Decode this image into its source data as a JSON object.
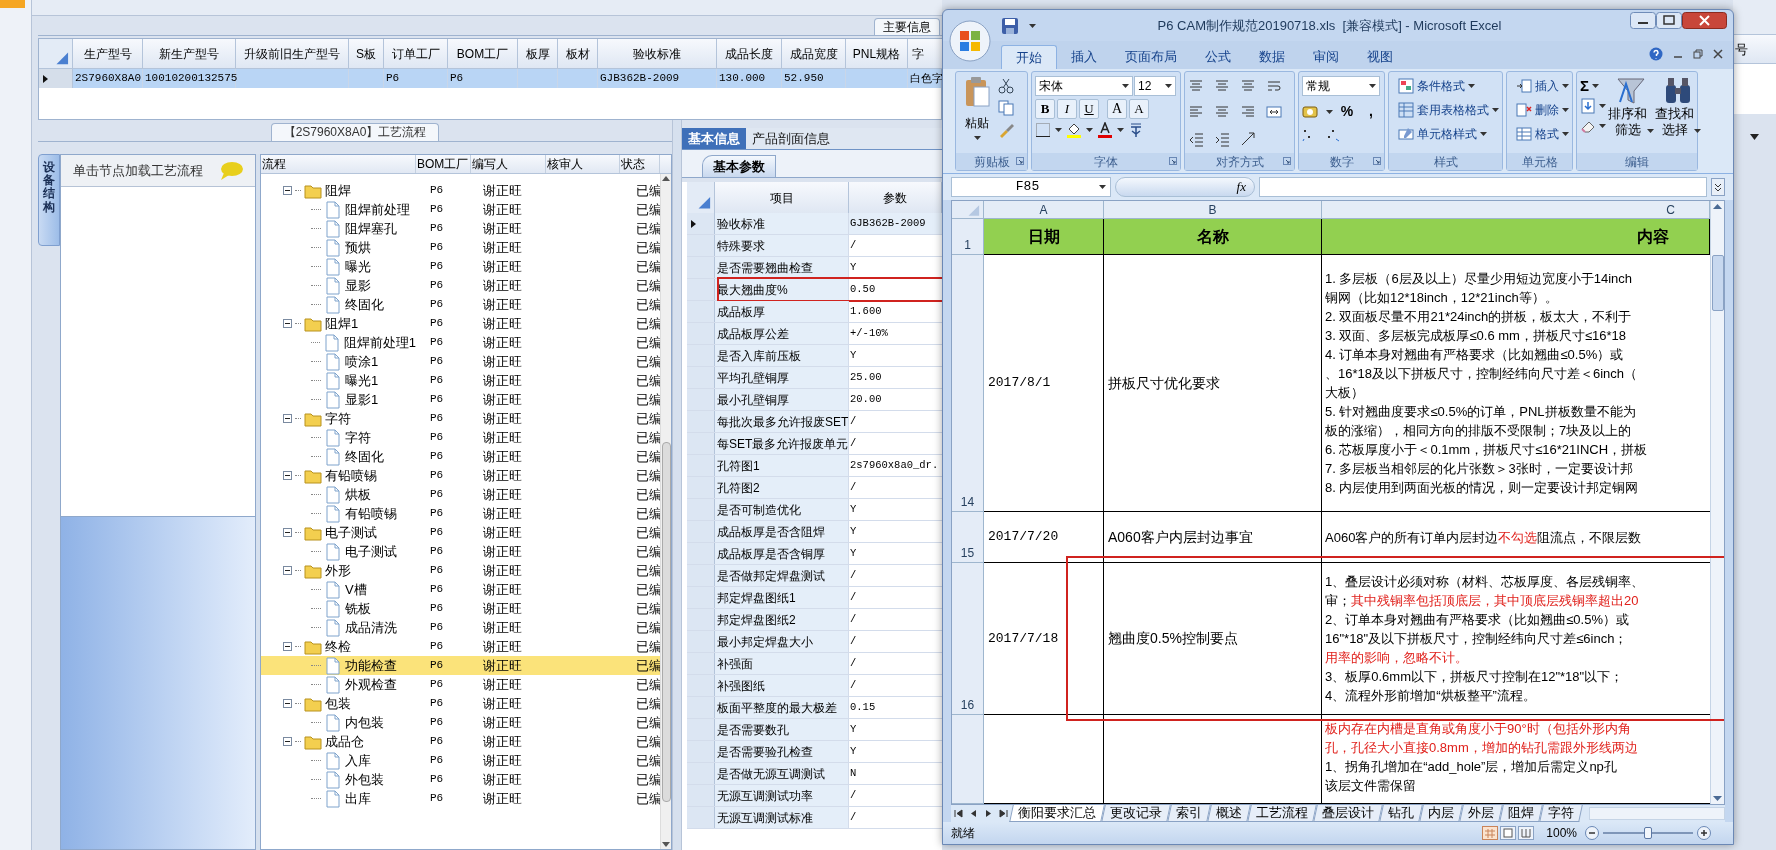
{
  "app": {
    "main_tab": "主要信息",
    "grid": {
      "columns": [
        "生产型号",
        "新生产型号",
        "升级前旧生产型号",
        "S板",
        "订单工厂",
        "BOM工厂",
        "板厚",
        "板材",
        "验收标准",
        "成品长度",
        "成品宽度",
        "PNL规格",
        "字"
      ],
      "rows": [
        {
          "selected": true,
          "current": true,
          "cells": [
            "2S7960X8A0",
            "10010200132575",
            "",
            "",
            "P6",
            "P6",
            "",
            "",
            "GJB362B-2009",
            "130.000",
            "52.950",
            "",
            "白色字"
          ]
        }
      ]
    },
    "left_panel": {
      "vertical_tab": "设备结构",
      "header": "单击节点加载工艺流程"
    },
    "process": {
      "title": "【2S7960X8A0】工艺流程",
      "columns": [
        "流程",
        "BOM工厂",
        "编写人",
        "核审人",
        "状态"
      ],
      "tree": [
        {
          "kind": "folder",
          "name": "阻焊",
          "factory": "P6",
          "writer": "谢正旺",
          "status": "已编",
          "expanded": true,
          "selected": false,
          "children": [
            {
              "kind": "step",
              "name": "阻焊前处理",
              "factory": "P6",
              "writer": "谢正旺",
              "status": "已编",
              "selected": false
            },
            {
              "kind": "step",
              "name": "阻焊塞孔",
              "factory": "P6",
              "writer": "谢正旺",
              "status": "已编",
              "selected": false
            },
            {
              "kind": "step",
              "name": "预烘",
              "factory": "P6",
              "writer": "谢正旺",
              "status": "已编",
              "selected": false
            },
            {
              "kind": "step",
              "name": "曝光",
              "factory": "P6",
              "writer": "谢正旺",
              "status": "已编",
              "selected": false
            },
            {
              "kind": "step",
              "name": "显影",
              "factory": "P6",
              "writer": "谢正旺",
              "status": "已编",
              "selected": false
            },
            {
              "kind": "step",
              "name": "终固化",
              "factory": "P6",
              "writer": "谢正旺",
              "status": "已编",
              "selected": false
            }
          ]
        },
        {
          "kind": "folder",
          "name": "阻焊1",
          "factory": "P6",
          "writer": "谢正旺",
          "status": "已编",
          "expanded": true,
          "selected": false,
          "children": [
            {
              "kind": "step",
              "name": "阻焊前处理1",
              "factory": "P6",
              "writer": "谢正旺",
              "status": "已编",
              "selected": false
            },
            {
              "kind": "step",
              "name": "喷涂1",
              "factory": "P6",
              "writer": "谢正旺",
              "status": "已编",
              "selected": false
            },
            {
              "kind": "step",
              "name": "曝光1",
              "factory": "P6",
              "writer": "谢正旺",
              "status": "已编",
              "selected": false
            },
            {
              "kind": "step",
              "name": "显影1",
              "factory": "P6",
              "writer": "谢正旺",
              "status": "已编",
              "selected": false
            }
          ]
        },
        {
          "kind": "folder",
          "name": "字符",
          "factory": "P6",
          "writer": "谢正旺",
          "status": "已编",
          "expanded": true,
          "selected": false,
          "children": [
            {
              "kind": "step",
              "name": "字符",
              "factory": "P6",
              "writer": "谢正旺",
              "status": "已编",
              "selected": false
            },
            {
              "kind": "step",
              "name": "终固化",
              "factory": "P6",
              "writer": "谢正旺",
              "status": "已编",
              "selected": false
            }
          ]
        },
        {
          "kind": "folder",
          "name": "有铅喷锡",
          "factory": "P6",
          "writer": "谢正旺",
          "status": "已编",
          "expanded": true,
          "selected": false,
          "children": [
            {
              "kind": "step",
              "name": "烘板",
              "factory": "P6",
              "writer": "谢正旺",
              "status": "已编",
              "selected": false
            },
            {
              "kind": "step",
              "name": "有铅喷锡",
              "factory": "P6",
              "writer": "谢正旺",
              "status": "已编",
              "selected": false
            }
          ]
        },
        {
          "kind": "folder",
          "name": "电子测试",
          "factory": "P6",
          "writer": "谢正旺",
          "status": "已编",
          "expanded": true,
          "selected": false,
          "children": [
            {
              "kind": "step",
              "name": "电子测试",
              "factory": "P6",
              "writer": "谢正旺",
              "status": "已编",
              "selected": false
            }
          ]
        },
        {
          "kind": "folder",
          "name": "外形",
          "factory": "P6",
          "writer": "谢正旺",
          "status": "已编",
          "expanded": true,
          "selected": false,
          "children": [
            {
              "kind": "step",
              "name": "V槽",
              "factory": "P6",
              "writer": "谢正旺",
              "status": "已编",
              "selected": false
            },
            {
              "kind": "step",
              "name": "铣板",
              "factory": "P6",
              "writer": "谢正旺",
              "status": "已编",
              "selected": false
            },
            {
              "kind": "step",
              "name": "成品清洗",
              "factory": "P6",
              "writer": "谢正旺",
              "status": "已编",
              "selected": false
            }
          ]
        },
        {
          "kind": "folder",
          "name": "终检",
          "factory": "P6",
          "writer": "谢正旺",
          "status": "已编",
          "expanded": true,
          "selected": false,
          "children": [
            {
              "kind": "step",
              "name": "功能检查",
              "factory": "P6",
              "writer": "谢正旺",
              "status": "已编",
              "selected": true
            },
            {
              "kind": "step",
              "name": "外观检查",
              "factory": "P6",
              "writer": "谢正旺",
              "status": "已编",
              "selected": false
            }
          ]
        },
        {
          "kind": "folder",
          "name": "包装",
          "factory": "P6",
          "writer": "谢正旺",
          "status": "已编",
          "expanded": true,
          "selected": false,
          "children": [
            {
              "kind": "step",
              "name": "内包装",
              "factory": "P6",
              "writer": "谢正旺",
              "status": "已编",
              "selected": false
            }
          ]
        },
        {
          "kind": "folder",
          "name": "成品仓",
          "factory": "P6",
          "writer": "谢正旺",
          "status": "已编",
          "expanded": true,
          "selected": false,
          "children": [
            {
              "kind": "step",
              "name": "入库",
              "factory": "P6",
              "writer": "谢正旺",
              "status": "已编",
              "selected": false
            },
            {
              "kind": "step",
              "name": "外包装",
              "factory": "P6",
              "writer": "谢正旺",
              "status": "已编",
              "selected": false
            },
            {
              "kind": "step",
              "name": "出库",
              "factory": "P6",
              "writer": "谢正旺",
              "status": "已编",
              "selected": false
            }
          ]
        }
      ]
    },
    "info": {
      "tabs": [
        {
          "label": "基本信息",
          "selected": true
        },
        {
          "label": "产品剖面信息",
          "selected": false
        }
      ],
      "subtab": "基本参数",
      "columns": [
        "项目",
        "参数"
      ],
      "rows": [
        {
          "item": "验收标准",
          "value": "GJB362B-2009",
          "current": true,
          "highlighted": false
        },
        {
          "item": "特殊要求",
          "value": "/",
          "current": false,
          "highlighted": false
        },
        {
          "item": "是否需要翘曲检查",
          "value": "Y",
          "current": false,
          "highlighted": false
        },
        {
          "item": "最大翘曲度%",
          "value": "0.50",
          "current": false,
          "highlighted": true
        },
        {
          "item": "成品板厚",
          "value": "1.600",
          "current": false,
          "highlighted": false
        },
        {
          "item": "成品板厚公差",
          "value": "+/-10%",
          "current": false,
          "highlighted": false
        },
        {
          "item": "是否入库前压板",
          "value": "Y",
          "current": false,
          "highlighted": false
        },
        {
          "item": "平均孔壁铜厚",
          "value": "25.00",
          "current": false,
          "highlighted": false
        },
        {
          "item": "最小孔壁铜厚",
          "value": "20.00",
          "current": false,
          "highlighted": false
        },
        {
          "item": "每批次最多允许报废SET",
          "value": "/",
          "current": false,
          "highlighted": false
        },
        {
          "item": "每SET最多允许报废单元",
          "value": "/",
          "current": false,
          "highlighted": false
        },
        {
          "item": "孔符图1",
          "value": "2s7960x8a0_dr.",
          "current": false,
          "highlighted": false
        },
        {
          "item": "孔符图2",
          "value": "/",
          "current": false,
          "highlighted": false
        },
        {
          "item": "是否可制造优化",
          "value": "Y",
          "current": false,
          "highlighted": false
        },
        {
          "item": "成品板厚是否含阻焊",
          "value": "Y",
          "current": false,
          "highlighted": false
        },
        {
          "item": "成品板厚是否含铜厚",
          "value": "Y",
          "current": false,
          "highlighted": false
        },
        {
          "item": "是否做邦定焊盘测试",
          "value": "/",
          "current": false,
          "highlighted": false
        },
        {
          "item": "邦定焊盘图纸1",
          "value": "/",
          "current": false,
          "highlighted": false
        },
        {
          "item": "邦定焊盘图纸2",
          "value": "/",
          "current": false,
          "highlighted": false
        },
        {
          "item": "最小邦定焊盘大小",
          "value": "/",
          "current": false,
          "highlighted": false
        },
        {
          "item": "补强面",
          "value": "/",
          "current": false,
          "highlighted": false
        },
        {
          "item": "补强图纸",
          "value": "/",
          "current": false,
          "highlighted": false
        },
        {
          "item": "板面平整度的最大极差",
          "value": "0.15",
          "current": false,
          "highlighted": false
        },
        {
          "item": "是否需要数孔",
          "value": "Y",
          "current": false,
          "highlighted": false
        },
        {
          "item": "是否需要验孔检查",
          "value": "Y",
          "current": false,
          "highlighted": false
        },
        {
          "item": "是否做无源互调测试",
          "value": "N",
          "current": false,
          "highlighted": false
        },
        {
          "item": "无源互调测试功率",
          "value": "/",
          "current": false,
          "highlighted": false
        },
        {
          "item": "无源互调测试标准",
          "value": "/",
          "current": false,
          "highlighted": false
        }
      ]
    },
    "right_edge": {
      "column_header": "号"
    }
  },
  "excel": {
    "title": "P6 CAM制作规范20190718.xls  [兼容模式] - Microsoft Excel",
    "ribbon_tabs": [
      {
        "label": "开始",
        "selected": true
      },
      {
        "label": "插入",
        "selected": false
      },
      {
        "label": "页面布局",
        "selected": false
      },
      {
        "label": "公式",
        "selected": false
      },
      {
        "label": "数据",
        "selected": false
      },
      {
        "label": "审阅",
        "selected": false
      },
      {
        "label": "视图",
        "selected": false
      }
    ],
    "groups": [
      {
        "kind": "clipboard",
        "label": "剪贴板",
        "commands": [
          "粘贴"
        ]
      },
      {
        "kind": "font",
        "label": "字体",
        "font_name": "宋体",
        "font_size": "12",
        "buttons": [
          "B",
          "I",
          "U",
          "A",
          "A"
        ]
      },
      {
        "kind": "alignment",
        "label": "对齐方式"
      },
      {
        "kind": "number",
        "label": "数字",
        "format": "常规",
        "symbols": [
          "%",
          ","
        ]
      },
      {
        "kind": "styles",
        "label": "样式",
        "commands": [
          "条件格式",
          "套用表格格式",
          "单元格样式"
        ]
      },
      {
        "kind": "cells",
        "label": "单元格",
        "commands": [
          "插入",
          "删除",
          "格式"
        ]
      },
      {
        "kind": "editing",
        "label": "编辑",
        "symbol": "Σ",
        "commands": [
          "排序和筛选",
          "查找和选择"
        ]
      }
    ],
    "name_box": "F85",
    "formula_label": "fx",
    "columns": [
      "A",
      "B",
      "C"
    ],
    "header_row": {
      "number": "1",
      "cells": [
        "日期",
        "名称",
        "内容"
      ]
    },
    "rows": [
      {
        "number": "14",
        "date": "2017/8/1",
        "name": "拼板尺寸优化要求",
        "highlighted": false,
        "lines": [
          [
            {
              "text": "1. 多层板（6层及以上）尽量少用短边宽度小于14inch",
              "red": false
            }
          ],
          [
            {
              "text": "铜网（比如12*18inch，12*21inch等）。",
              "red": false
            }
          ],
          [
            {
              "text": "2. 双面板尽量不用21*24inch的拼板，板太大，不利于",
              "red": false
            }
          ],
          [
            {
              "text": "3. 双面、多层板完成板厚≤0.6 mm，拼板尺寸≤16*18",
              "red": false
            }
          ],
          [
            {
              "text": "4. 订单本身对翘曲有严格要求（比如翘曲≤0.5%）或",
              "red": false
            }
          ],
          [
            {
              "text": "、16*18及以下拼板尺寸，控制经纬向尺寸差＜6inch（",
              "red": false
            }
          ],
          [
            {
              "text": "大板）",
              "red": false
            }
          ],
          [
            {
              "text": "5. 针对翘曲度要求≤0.5%的订单，PNL拼板数量不能为",
              "red": false
            }
          ],
          [
            {
              "text": "板的涨缩），相同方向的排版不受限制；7块及以上的",
              "red": false
            }
          ],
          [
            {
              "text": "6. 芯板厚度小于＜0.1mm，拼板尺寸≤16*21INCH，拼板",
              "red": false
            }
          ],
          [
            {
              "text": "7. 多层板当相邻层的化片张数＞3张时，一定要设计邦",
              "red": false
            }
          ],
          [
            {
              "text": "8. 内层使用到两面光板的情况，则一定要设计邦定铜网",
              "red": false
            }
          ]
        ]
      },
      {
        "number": "15",
        "date": "2017/7/20",
        "name": "A060客户内层封边事宜",
        "highlighted": false,
        "lines": [
          [
            {
              "text": "A060客户的所有订单内层封边",
              "red": false
            },
            {
              "text": "不勾选",
              "red": true
            },
            {
              "text": "阻流点，不限层数",
              "red": false
            }
          ]
        ]
      },
      {
        "number": "16",
        "date": "2017/7/18",
        "name": "翘曲度0.5%控制要点",
        "highlighted": true,
        "lines": [
          [
            {
              "text": "1、叠层设计必须对称（材料、芯板厚度、各层残铜率、",
              "red": false
            }
          ],
          [
            {
              "text": "审；",
              "red": false
            },
            {
              "text": "其中残铜率包括顶底层，其中顶底层残铜率超出20",
              "red": true
            }
          ],
          [
            {
              "text": "2、订单本身对翘曲有严格要求（比如翘曲≤0.5%）或",
              "red": false
            }
          ],
          [
            {
              "text": "16\"*18\"及以下拼板尺寸，控制经纬向尺寸差≤6inch；",
              "red": false
            }
          ],
          [
            {
              "text": "用率的影响，忽略不计。",
              "red": true
            }
          ],
          [
            {
              "text": "3、板厚0.6mm以下，拼板尺寸控制在12\"*18\"以下；",
              "red": false
            }
          ],
          [
            {
              "text": "4、流程外形前增加“烘板整平”流程。",
              "red": false
            }
          ]
        ]
      },
      {
        "number": "",
        "date": "",
        "name": "",
        "highlighted": false,
        "lines": [
          [
            {
              "text": "板内存在内槽是直角或角度小于90°时（包括外形内角",
              "red": true
            }
          ],
          [
            {
              "text": "孔，孔径大小直接0.8mm，增加的钻孔需跟外形线两边",
              "red": true
            }
          ],
          [
            {
              "text": "1、拐角孔增加在“add_hole”层，增加后需定义np孔",
              "red": false
            }
          ],
          [
            {
              "text": "该层文件需保留",
              "red": false
            }
          ]
        ]
      }
    ],
    "sheet_tabs": [
      {
        "label": "衡阳要求汇总",
        "selected": true
      },
      {
        "label": "更改记录",
        "selected": false
      },
      {
        "label": "索引",
        "selected": false
      },
      {
        "label": "概述",
        "selected": false
      },
      {
        "label": "工艺流程",
        "selected": false
      },
      {
        "label": "叠层设计",
        "selected": false
      },
      {
        "label": "钻孔",
        "selected": false
      },
      {
        "label": "内层",
        "selected": false
      },
      {
        "label": "外层",
        "selected": false
      },
      {
        "label": "阻焊",
        "selected": false
      },
      {
        "label": "字符",
        "selected": false
      }
    ],
    "status": "就绪",
    "zoom": {
      "reading": "100%",
      "level": 0.5
    }
  }
}
